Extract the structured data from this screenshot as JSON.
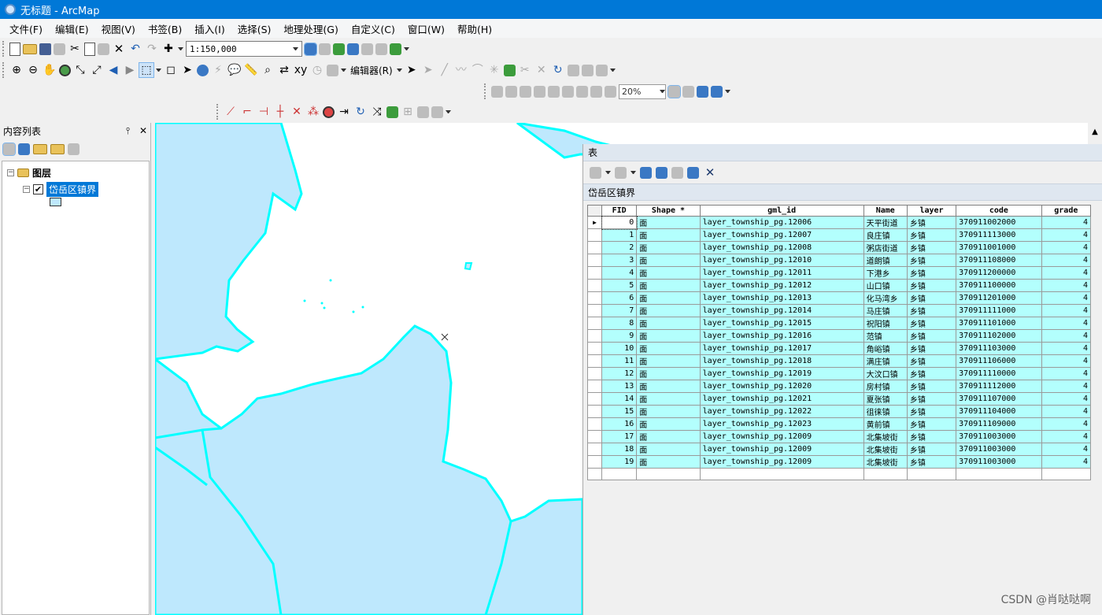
{
  "window": {
    "title": "无标题 - ArcMap"
  },
  "menu": [
    "文件(F)",
    "编辑(E)",
    "视图(V)",
    "书签(B)",
    "插入(I)",
    "选择(S)",
    "地理处理(G)",
    "自定义(C)",
    "窗口(W)",
    "帮助(H)"
  ],
  "toolbar": {
    "scale": "1:150,000",
    "editor": "编辑器(R)",
    "zoom": "20%"
  },
  "toc": {
    "title": "内容列表",
    "pin_icon": "pin-icon",
    "close_icon": "close-icon",
    "root_label": "图层",
    "layer_label": "岱岳区镇界"
  },
  "table_window": {
    "title": "表",
    "layer_tab": "岱岳区镇界",
    "columns": [
      "FID",
      "Shape *",
      "gml_id",
      "Name",
      "layer",
      "code",
      "grade"
    ],
    "rows": [
      [
        "0",
        "面",
        "layer_township_pg.12006",
        "天平街道",
        "乡镇",
        "370911002000",
        "4"
      ],
      [
        "1",
        "面",
        "layer_township_pg.12007",
        "良庄镇",
        "乡镇",
        "370911113000",
        "4"
      ],
      [
        "2",
        "面",
        "layer_township_pg.12008",
        "粥店街道",
        "乡镇",
        "370911001000",
        "4"
      ],
      [
        "3",
        "面",
        "layer_township_pg.12010",
        "道朗镇",
        "乡镇",
        "370911108000",
        "4"
      ],
      [
        "4",
        "面",
        "layer_township_pg.12011",
        "下港乡",
        "乡镇",
        "370911200000",
        "4"
      ],
      [
        "5",
        "面",
        "layer_township_pg.12012",
        "山口镇",
        "乡镇",
        "370911100000",
        "4"
      ],
      [
        "6",
        "面",
        "layer_township_pg.12013",
        "化马湾乡",
        "乡镇",
        "370911201000",
        "4"
      ],
      [
        "7",
        "面",
        "layer_township_pg.12014",
        "马庄镇",
        "乡镇",
        "370911111000",
        "4"
      ],
      [
        "8",
        "面",
        "layer_township_pg.12015",
        "祝阳镇",
        "乡镇",
        "370911101000",
        "4"
      ],
      [
        "9",
        "面",
        "layer_township_pg.12016",
        "范镇",
        "乡镇",
        "370911102000",
        "4"
      ],
      [
        "10",
        "面",
        "layer_township_pg.12017",
        "角峪镇",
        "乡镇",
        "370911103000",
        "4"
      ],
      [
        "11",
        "面",
        "layer_township_pg.12018",
        "满庄镇",
        "乡镇",
        "370911106000",
        "4"
      ],
      [
        "12",
        "面",
        "layer_township_pg.12019",
        "大汶口镇",
        "乡镇",
        "370911110000",
        "4"
      ],
      [
        "13",
        "面",
        "layer_township_pg.12020",
        "房村镇",
        "乡镇",
        "370911112000",
        "4"
      ],
      [
        "14",
        "面",
        "layer_township_pg.12021",
        "夏张镇",
        "乡镇",
        "370911107000",
        "4"
      ],
      [
        "15",
        "面",
        "layer_township_pg.12022",
        "徂徕镇",
        "乡镇",
        "370911104000",
        "4"
      ],
      [
        "16",
        "面",
        "layer_township_pg.12023",
        "黄前镇",
        "乡镇",
        "370911109000",
        "4"
      ],
      [
        "17",
        "面",
        "layer_township_pg.12009",
        "北集坡街",
        "乡镇",
        "370911003000",
        "4"
      ],
      [
        "18",
        "面",
        "layer_township_pg.12009",
        "北集坡街",
        "乡镇",
        "370911003000",
        "4"
      ],
      [
        "19",
        "面",
        "layer_township_pg.12009",
        "北集坡街",
        "乡镇",
        "370911003000",
        "4"
      ]
    ]
  },
  "colors": {
    "polygon_fill": "#bee8fd",
    "boundary": "#00ffff",
    "titlebar": "#0078d7",
    "row_fill": "#b3fffd"
  },
  "watermark": "CSDN @肖哒哒啊"
}
